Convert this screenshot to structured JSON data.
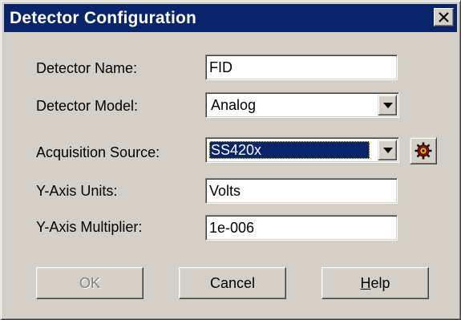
{
  "dialog": {
    "title": "Detector Configuration",
    "close_icon": "close-icon"
  },
  "form": {
    "detector_name": {
      "label": "Detector Name:",
      "value": "FID"
    },
    "detector_model": {
      "label": "Detector Model:",
      "value": "Analog"
    },
    "acquisition_source": {
      "label": "Acquisition Source:",
      "value": "SS420x",
      "config_icon": "gear-icon"
    },
    "y_axis_units": {
      "label": "Y-Axis Units:",
      "value": "Volts"
    },
    "y_axis_multiplier": {
      "label": "Y-Axis Multiplier:",
      "value": "1e-006"
    }
  },
  "buttons": {
    "ok": {
      "label": "OK",
      "enabled": false
    },
    "cancel": {
      "label": "Cancel"
    },
    "help": {
      "label_accel": "H",
      "label_rest": "elp"
    }
  },
  "colors": {
    "titlebar": "#0a246a",
    "face": "#d4d0c8",
    "selection": "#0a246a"
  }
}
